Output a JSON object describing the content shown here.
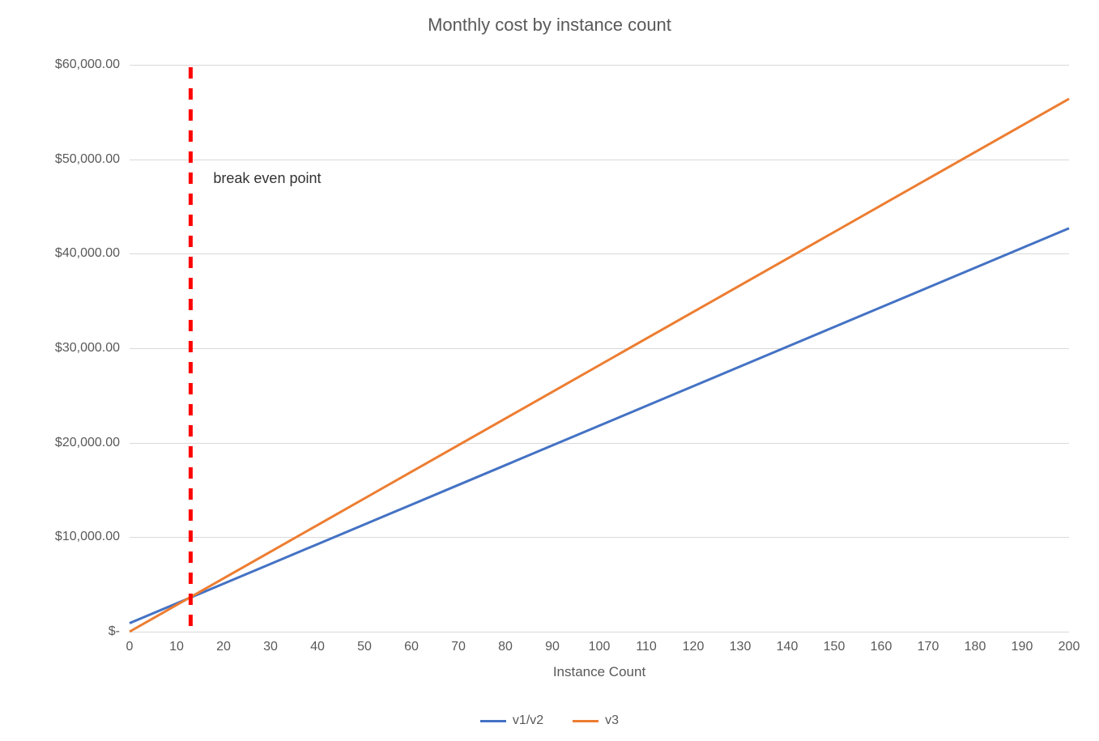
{
  "chart_data": {
    "type": "line",
    "title": "Monthly cost by instance count",
    "xlabel": "Instance Count",
    "ylabel": "",
    "x": [
      0,
      10,
      20,
      30,
      40,
      50,
      60,
      70,
      80,
      90,
      100,
      110,
      120,
      130,
      140,
      150,
      160,
      170,
      180,
      190,
      200
    ],
    "series": [
      {
        "name": "v1/v2",
        "color": "#4472C4",
        "values": [
          900,
          2990,
          5080,
          7170,
          9260,
          11350,
          13440,
          15530,
          17620,
          19710,
          21800,
          23890,
          25980,
          28070,
          30160,
          32250,
          34340,
          36430,
          38520,
          40610,
          42700
        ]
      },
      {
        "name": "v3",
        "color": "#ED7D31",
        "values": [
          0,
          2820,
          5640,
          8460,
          11280,
          14100,
          16920,
          19740,
          22560,
          25380,
          28200,
          31020,
          33840,
          36660,
          39480,
          42300,
          45120,
          47940,
          50760,
          53580,
          56400
        ]
      }
    ],
    "xlim": [
      0,
      200
    ],
    "ylim": [
      0,
      60000
    ],
    "x_ticks": [
      0,
      10,
      20,
      30,
      40,
      50,
      60,
      70,
      80,
      90,
      100,
      110,
      120,
      130,
      140,
      150,
      160,
      170,
      180,
      190,
      200
    ],
    "y_ticks": [
      0,
      10000,
      20000,
      30000,
      40000,
      50000,
      60000
    ],
    "y_tick_labels": [
      "$-",
      "$10,000.00",
      "$20,000.00",
      "$30,000.00",
      "$40,000.00",
      "$50,000.00",
      "$60,000.00"
    ],
    "grid": true,
    "annotation": {
      "text": "break even point",
      "x": 13,
      "line_color": "#FF0000",
      "line_style": "dashed"
    },
    "legend_position": "bottom"
  }
}
